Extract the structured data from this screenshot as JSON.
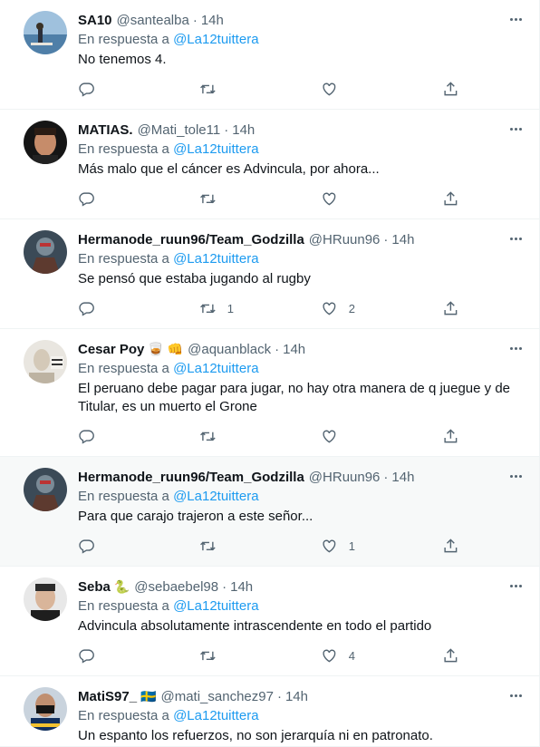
{
  "reply_prefix": "En respuesta a",
  "tweets": [
    {
      "name": "SA10",
      "badge": "",
      "handle": "@santealba",
      "time": "14h",
      "mention": "@La12tuittera",
      "text": "No tenemos 4.",
      "replies": "",
      "retweets": "",
      "likes": ""
    },
    {
      "name": "MATIAS.",
      "badge": "",
      "handle": "@Mati_tole11",
      "time": "14h",
      "mention": "@La12tuittera",
      "text": "Más malo que el cáncer es Advincula, por ahora...",
      "replies": "",
      "retweets": "",
      "likes": ""
    },
    {
      "name": "Hermanode_ruun96/Team_Godzilla",
      "badge": "",
      "handle": "@HRuun96",
      "time": "14h",
      "mention": "@La12tuittera",
      "text": "Se pensó que estaba jugando al rugby",
      "replies": "",
      "retweets": "1",
      "likes": "2"
    },
    {
      "name": "Cesar Poy",
      "badge": "🥃 👊",
      "handle": "@aquanblack",
      "time": "14h",
      "mention": "@La12tuittera",
      "text": "El peruano debe pagar para jugar, no hay otra manera de q juegue y de Titular, es un muerto el Grone",
      "replies": "",
      "retweets": "",
      "likes": ""
    },
    {
      "name": "Hermanode_ruun96/Team_Godzilla",
      "badge": "",
      "handle": "@HRuun96",
      "time": "14h",
      "mention": "@La12tuittera",
      "text": "Para que carajo trajeron a este señor...",
      "replies": "",
      "retweets": "",
      "likes": "1"
    },
    {
      "name": "Seba",
      "badge": "🐍",
      "handle": "@sebaebel98",
      "time": "14h",
      "mention": "@La12tuittera",
      "text": "Advincula absolutamente intrascendente en todo el partido",
      "replies": "",
      "retweets": "",
      "likes": "4"
    },
    {
      "name": "MatiS97_",
      "badge": "🇸🇪",
      "handle": "@mati_sanchez97",
      "time": "14h",
      "mention": "@La12tuittera",
      "text": "Un espanto los refuerzos, no son jerarquía ni en patronato.",
      "replies": "",
      "retweets": "",
      "likes": ""
    }
  ],
  "colors": {
    "accent": "#1d9bf0",
    "secondary_text": "#536471",
    "border": "#eff3f4",
    "hover_bg": "#f7f9f9"
  },
  "icons": {
    "reply": "comment-icon",
    "retweet": "retweet-icon",
    "like": "heart-icon",
    "share": "share-icon",
    "more": "more-icon"
  }
}
